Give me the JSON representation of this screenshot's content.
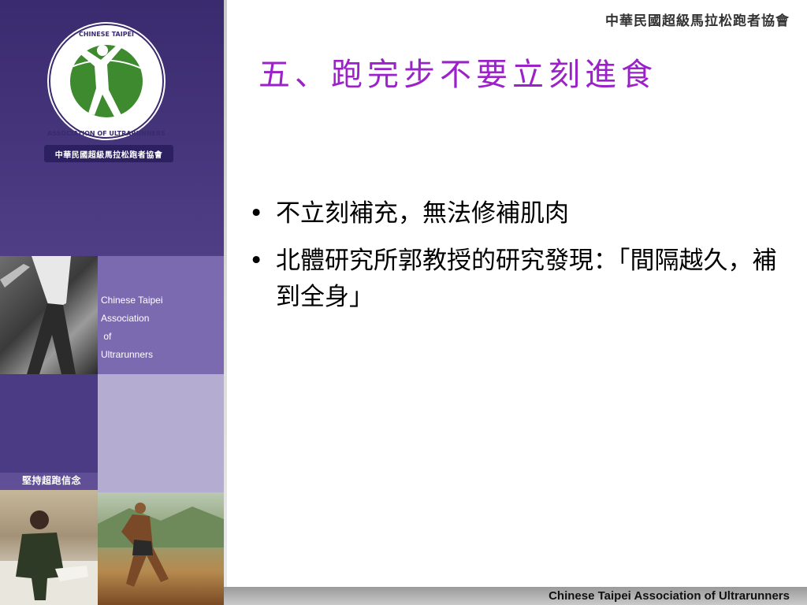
{
  "header": {
    "org_name": "中華民國超級馬拉松跑者協會"
  },
  "sidebar": {
    "logo_caption": "中華民國超級馬拉松跑者協會",
    "logo_ring_text": "CHINESE TAIPEI · ASSOCIATION OF ULTRARUNNERS",
    "assoc_lines": [
      "Chinese Taipei",
      "Association",
      " of",
      "Ultrarunners"
    ],
    "motto": "堅持超跑信念"
  },
  "slide": {
    "title": "五、跑完步不要立刻進食",
    "bullets": [
      {
        "marker": "•",
        "text": "不立刻補充，無法修補肌肉"
      },
      {
        "marker": "•",
        "text": "北體研究所郭教授的研究發現：「間隔越久，補到全身」"
      }
    ]
  },
  "footer": {
    "text": "Chinese Taipei Association of Ultrarunners"
  },
  "colors": {
    "title": "#9b22c8",
    "sidebar": "#4c3a82",
    "logo_green": "#3e8a2e"
  }
}
